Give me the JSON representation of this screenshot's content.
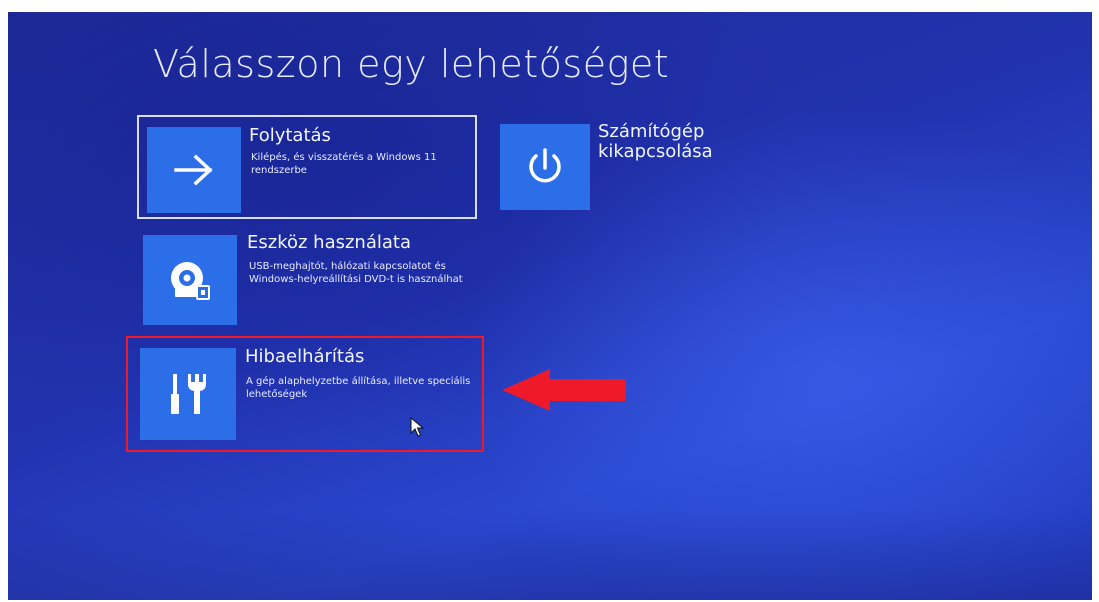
{
  "screen": {
    "title": "Válasszon egy lehetőséget",
    "background_color": "#2233b0",
    "tile_color": "#2c6ee8"
  },
  "options": [
    {
      "title": "Folytatás",
      "description": "Kilépés, és visszatérés a Windows 11 rendszerbe",
      "icon": "arrow-right-icon",
      "selected": true
    },
    {
      "title": "Számítógép kikapcsolása",
      "description": "",
      "icon": "power-icon",
      "selected": false
    },
    {
      "title": "Eszköz használata",
      "description": "USB-meghajtót, hálózati kapcsolatot és Windows-helyreállítási DVD-t is használhat",
      "icon": "disc-usb-icon",
      "selected": false
    },
    {
      "title": "Hibaelhárítás",
      "description": "A gép alaphelyzetbe állítása, illetve speciális lehetőségek",
      "icon": "tools-icon",
      "selected": false,
      "annotated": true
    }
  ],
  "annotation": {
    "highlight_color": "#ee1a2a",
    "arrow_icon": "red-arrow-left-icon"
  }
}
